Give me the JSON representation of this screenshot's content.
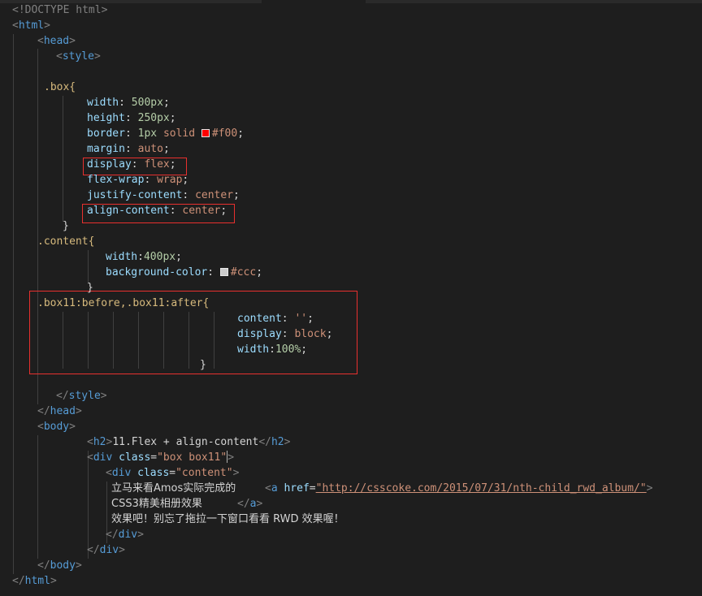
{
  "code": {
    "doctype": "<!DOCTYPE html>",
    "html_open": "<html>",
    "head_open": "<head>",
    "style_open": "<style>",
    "box_selector": ".box{",
    "box_rules": [
      {
        "prop": "width",
        "sep": ": ",
        "num": "500px",
        "end": ";"
      },
      {
        "prop": "height",
        "sep": ": ",
        "num": "250px",
        "end": ";"
      },
      {
        "prop": "border",
        "sep": ": ",
        "num": "1px",
        "kw": "solid",
        "color": "#f00",
        "end": ";"
      },
      {
        "prop": "margin",
        "sep": ": ",
        "kw": "auto",
        "end": ";"
      },
      {
        "prop": "display",
        "sep": ": ",
        "kw": "flex",
        "end": ";"
      },
      {
        "prop": "flex-wrap",
        "sep": ": ",
        "kw": "wrap",
        "end": ";"
      },
      {
        "prop": "justify-content",
        "sep": ": ",
        "kw": "center",
        "end": ";"
      },
      {
        "prop": "align-content",
        "sep": ": ",
        "kw": "center",
        "end": ";"
      }
    ],
    "box_close": "}",
    "content_selector": ".content{",
    "content_rules": [
      {
        "prop": "width",
        "sep": ":",
        "num": "400px",
        "end": ";"
      },
      {
        "prop": "background-color",
        "sep": ": ",
        "color": "#ccc",
        "end": ";"
      }
    ],
    "content_close": "}",
    "pseudo_selector": ".box11:before,.box11:after{",
    "pseudo_rules": [
      {
        "prop": "content",
        "sep": ": ",
        "kw": "''",
        "end": ";"
      },
      {
        "prop": "display",
        "sep": ": ",
        "kw": "block",
        "end": ";"
      },
      {
        "prop": "width",
        "sep": ":",
        "num": "100%",
        "end": ";"
      }
    ],
    "pseudo_close": "}",
    "style_close": "</style>",
    "head_close": "</head>",
    "body_open": "<body>",
    "h2_text": "11.Flex + align-content",
    "div_box_class": "\"box box11\"",
    "div_content_class": "\"content\"",
    "text_part1": "立马来看Amos实际完成的",
    "link_href": "\"http://csscoke.com/2015/07/31/nth-child_rwd_album/\"",
    "text_part2": "CSS3精美相册效果",
    "text_part3": "效果吧！别忘了拖拉一下窗口看看 RWD 效果喔！",
    "div_close": "</div>",
    "a_close": "</a>",
    "body_close": "</body>",
    "html_close": "</html>"
  },
  "colors": {
    "background": "#1e1e1e",
    "tag": "#569cd6",
    "attribute": "#9cdcfe",
    "string": "#ce9178",
    "number": "#b5cea8",
    "selector": "#d7ba7d",
    "highlight_box": "#e8302e",
    "swatch_red": "#ff0000",
    "swatch_grey": "#cccccc"
  }
}
